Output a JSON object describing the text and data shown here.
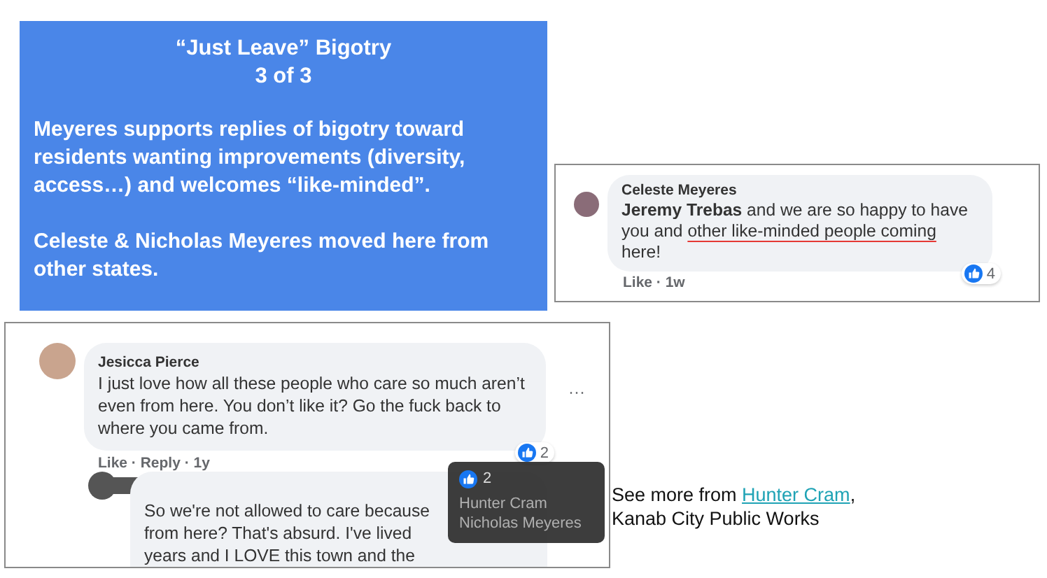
{
  "slide": {
    "title": "“Just Leave” Bigotry",
    "subtitle": "3 of 3",
    "paragraphs": [
      "Meyeres supports replies of bigotry toward residents wanting improvements (diversity, access…) and welcomes “like-minded”.",
      "Celeste & Nicholas Meyeres moved here from other states."
    ]
  },
  "comment_top": {
    "author": "Celeste Meyeres",
    "segments": [
      {
        "text": "**Jeremy Trebas** and we are so happy to have you and ",
        "underlined": false
      },
      {
        "text": "other like-minded people coming",
        "underlined": true
      },
      {
        "text": " here!",
        "underlined": false
      }
    ],
    "meta": "Like · 1w",
    "reaction_count": "4"
  },
  "comment_bottom": {
    "author": "Jesicca Pierce",
    "text": "I just love how all these people who care so much aren’t even from here. You don’t like it? Go the fuck back to where you came from.",
    "meta": "Like · Reply · 1y",
    "reaction_count": "2",
    "more": "···",
    "reply": {
      "lines": [
        "So we're not allowed to care because",
        "from here? That's absurd. I've lived",
        "years and I LOVE this town and the"
      ]
    },
    "tooltip": {
      "count": "2",
      "names": [
        "Hunter Cram",
        "Nicholas Meyeres"
      ]
    }
  },
  "caption": {
    "prefix": "See more from ",
    "link": "Hunter Cram",
    "suffix": ",",
    "line2": "Kanab City Public Works"
  }
}
